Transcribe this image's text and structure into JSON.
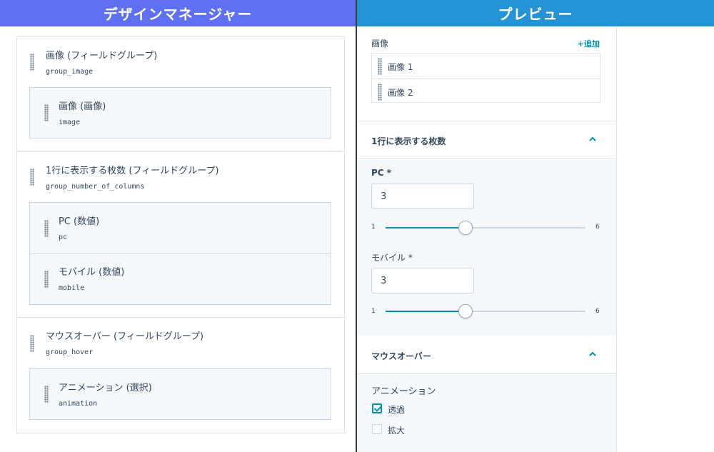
{
  "headers": {
    "left": "デザインマネージャー",
    "right": "プレビュー"
  },
  "design_manager": {
    "groups": [
      {
        "title": "画像 (フィールドグループ)",
        "code": "group_image",
        "children": [
          {
            "title": "画像 (画像)",
            "code": "image"
          }
        ]
      },
      {
        "title": "1行に表示する枚数 (フィールドグループ)",
        "code": "group_number_of_columns",
        "children": [
          {
            "title": "PC (数値)",
            "code": "pc"
          },
          {
            "title": "モバイル (数値)",
            "code": "mobile"
          }
        ]
      },
      {
        "title": "マウスオーバー (フィールドグループ)",
        "code": "group_hover",
        "children": [
          {
            "title": "アニメーション (選択)",
            "code": "animation"
          }
        ]
      }
    ]
  },
  "preview": {
    "images": {
      "label": "画像",
      "add_label": "+追加",
      "items": [
        "画像 1",
        "画像 2"
      ]
    },
    "columns": {
      "title": "1行に表示する枚数",
      "pc": {
        "label": "PC *",
        "value": "3",
        "min": "1",
        "max": "6",
        "fraction": 0.4
      },
      "mobile": {
        "label": "モバイル *",
        "value": "3",
        "min": "1",
        "max": "6",
        "fraction": 0.4
      }
    },
    "hover": {
      "title": "マウスオーバー",
      "animation_label": "アニメーション",
      "options": [
        {
          "label": "透過",
          "checked": true
        },
        {
          "label": "拡大",
          "checked": false
        }
      ]
    }
  },
  "colors": {
    "left_header": "#5e6ff0",
    "right_header": "#2593d3",
    "accent": "#0091ae"
  }
}
